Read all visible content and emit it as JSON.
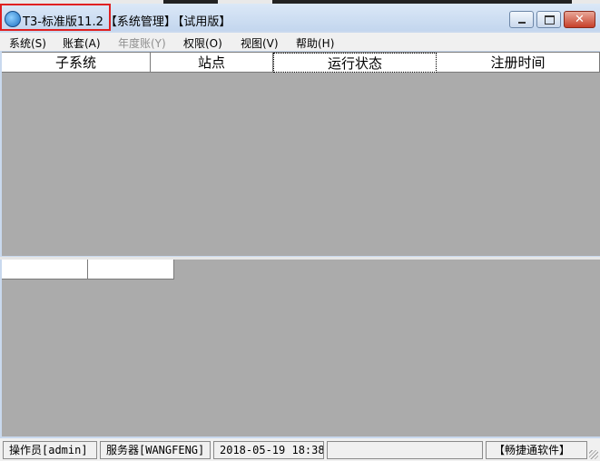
{
  "window": {
    "title_main": "T3-标准版11.2",
    "title_module": "【系统管理】",
    "title_edition": "【试用版】",
    "controls": {
      "minimize": "minimize-icon",
      "maximize": "maximize-icon",
      "close_glyph": "✕"
    }
  },
  "menu": {
    "items": [
      {
        "label": "系统(S)",
        "enabled": true
      },
      {
        "label": "账套(A)",
        "enabled": true
      },
      {
        "label": "年度账(Y)",
        "enabled": false
      },
      {
        "label": "权限(O)",
        "enabled": true
      },
      {
        "label": "视图(V)",
        "enabled": true
      },
      {
        "label": "帮助(H)",
        "enabled": true
      }
    ]
  },
  "top_table": {
    "columns": [
      "子系统",
      "站点",
      "运行状态",
      "注册时间"
    ]
  },
  "status": {
    "operator": "操作员[admin]",
    "server": "服务器[WANGFENG]",
    "datetime": "2018-05-19 18:38",
    "brand": "【畅捷通软件】"
  },
  "colors": {
    "pane_bg": "#ababab",
    "title_bg": "#c9d9ee",
    "highlight": "#e02020"
  }
}
